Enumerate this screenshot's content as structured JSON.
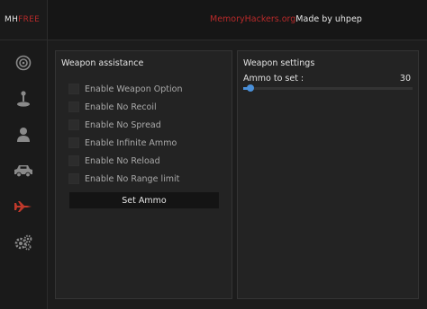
{
  "brand": {
    "prefix": "MH",
    "suffix": "FREE"
  },
  "header": {
    "site": "MemoryHackers.org",
    "by": "Made by uhpep"
  },
  "sidebar": {
    "items": [
      {
        "icon": "target-icon",
        "active": false
      },
      {
        "icon": "joystick-icon",
        "active": false
      },
      {
        "icon": "user-icon",
        "active": false
      },
      {
        "icon": "car-icon",
        "active": false
      },
      {
        "icon": "jet-icon",
        "active": true
      },
      {
        "icon": "gears-icon",
        "active": false
      }
    ]
  },
  "weapon_assistance": {
    "title": "Weapon assistance",
    "options": [
      {
        "label": "Enable Weapon Option",
        "checked": false
      },
      {
        "label": "Enable No Recoil",
        "checked": false
      },
      {
        "label": "Enable No Spread",
        "checked": false
      },
      {
        "label": "Enable Infinite Ammo",
        "checked": false
      },
      {
        "label": "Enable No Reload",
        "checked": false
      },
      {
        "label": "Enable No Range limit",
        "checked": false
      }
    ],
    "button": "Set Ammo"
  },
  "weapon_settings": {
    "title": "Weapon settings",
    "ammo_label": "Ammo to set :",
    "ammo_value": "30",
    "ammo_fraction": 0.04
  },
  "colors": {
    "accent": "#b72a2a",
    "slider": "#4a90d9",
    "background": "#1c1c1c"
  }
}
